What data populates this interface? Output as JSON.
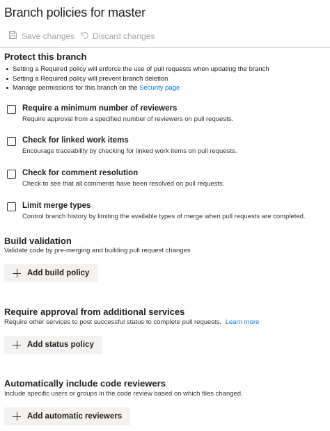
{
  "title": "Branch policies for master",
  "toolbar": {
    "save_label": "Save changes",
    "discard_label": "Discard changes"
  },
  "protect": {
    "title": "Protect this branch",
    "bullets": [
      "Setting a Required policy will enforce the use of pull requests when updating the branch",
      "Setting a Required policy will prevent branch deletion"
    ],
    "permissions_text": "Manage permissions for this branch on the ",
    "permissions_link": "Security page"
  },
  "policies": [
    {
      "title": "Require a minimum number of reviewers",
      "description": "Require approval from a specified number of reviewers on pull requests.",
      "checked": false
    },
    {
      "title": "Check for linked work items",
      "description": "Encourage traceability by checking for linked work items on pull requests.",
      "checked": false
    },
    {
      "title": "Check for comment resolution",
      "description": "Check to see that all comments have been resolved on pull requests.",
      "checked": false
    },
    {
      "title": "Limit merge types",
      "description": "Control branch history by limiting the available types of merge when pull requests are completed.",
      "checked": false
    }
  ],
  "build_validation": {
    "title": "Build validation",
    "description": "Validate code by pre-merging and building pull request changes",
    "button": "Add build policy"
  },
  "status": {
    "title": "Require approval from additional services",
    "description": "Require other services to post successful status to complete pull requests.",
    "learn_more": "Learn more",
    "button": "Add status policy"
  },
  "reviewers": {
    "title": "Automatically include code reviewers",
    "description": "Include specific users or groups in the code review based on which files changed.",
    "button": "Add automatic reviewers"
  },
  "icons": {
    "save": "save-icon",
    "discard": "undo-icon",
    "add": "plus-icon"
  },
  "colors": {
    "link": "#0078d4",
    "disabled": "#a6a6a6",
    "button_bg": "#f3f2f1"
  }
}
